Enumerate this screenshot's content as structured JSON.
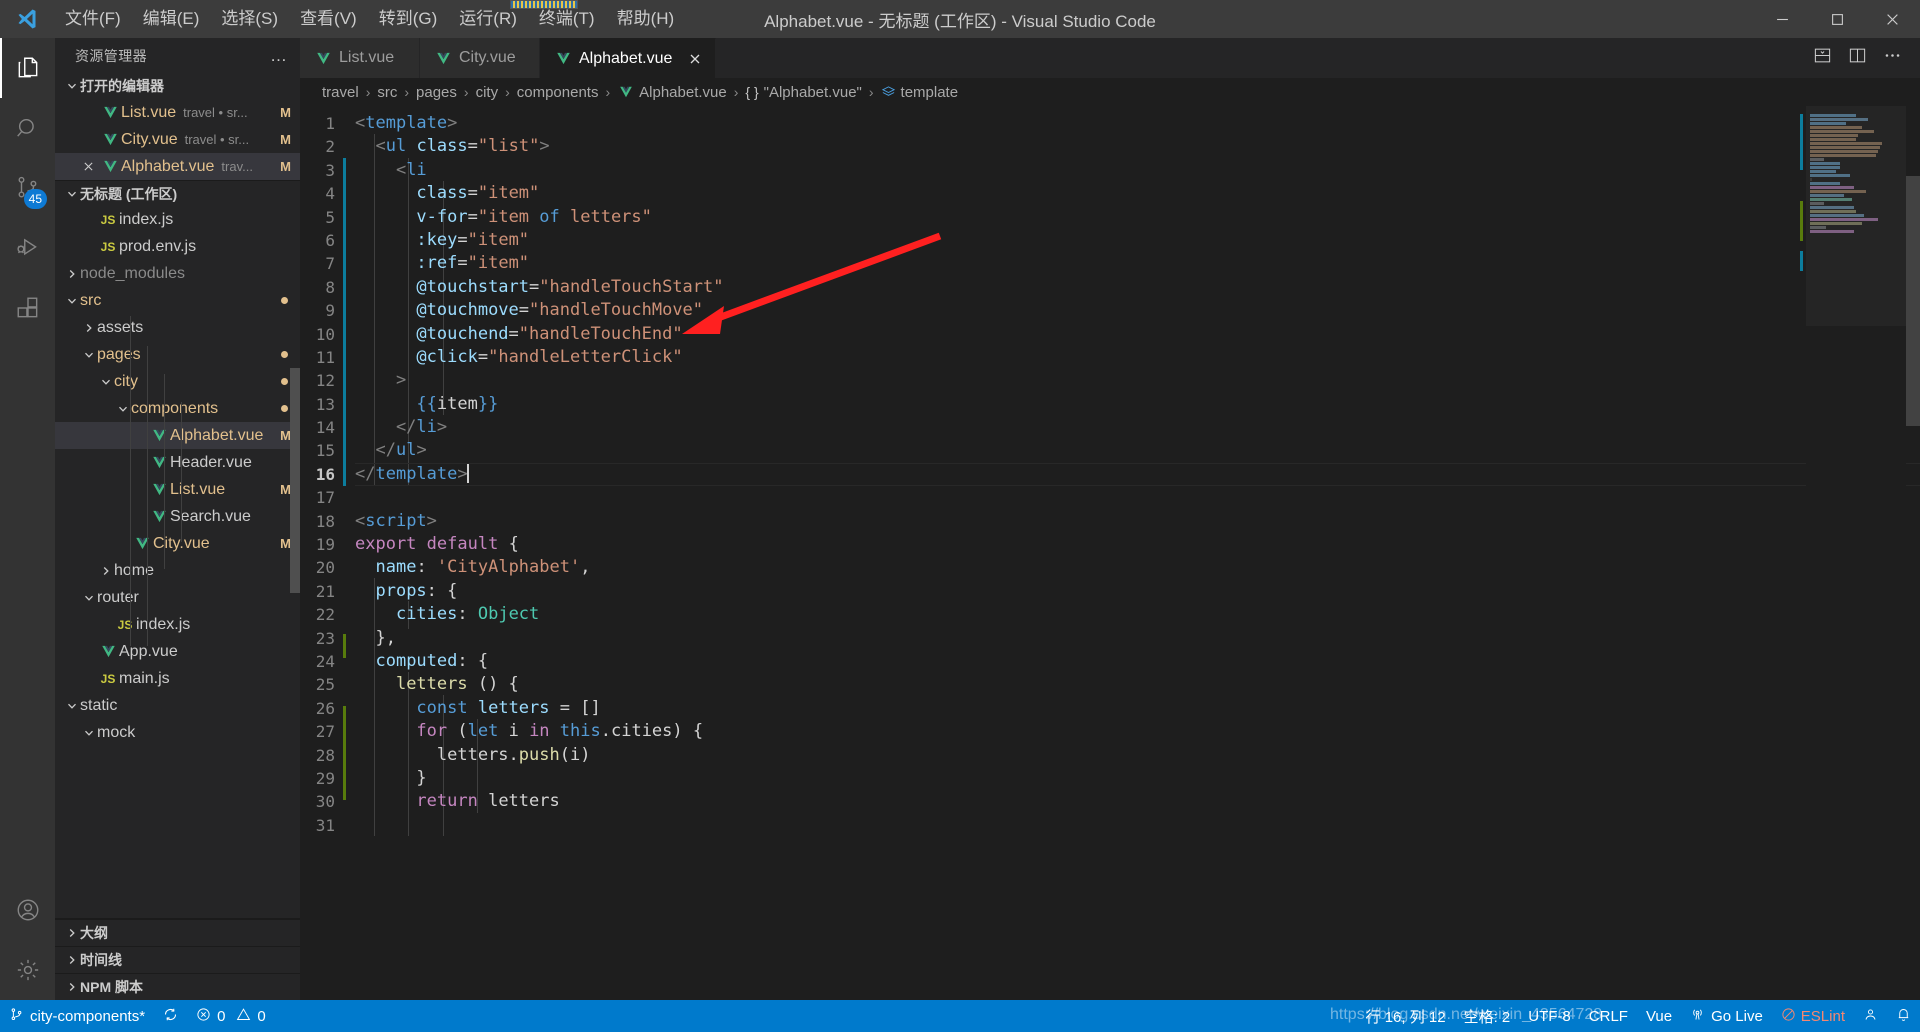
{
  "window": {
    "title": "Alphabet.vue - 无标题 (工作区) - Visual Studio Code",
    "logo_icon": "vscode-logo-icon",
    "minimize_icon": "minimize-icon",
    "maximize_icon": "maximize-icon",
    "close_icon": "close-icon"
  },
  "menu": [
    {
      "label": "文件(F)",
      "name": "menu-file"
    },
    {
      "label": "编辑(E)",
      "name": "menu-edit"
    },
    {
      "label": "选择(S)",
      "name": "menu-selection"
    },
    {
      "label": "查看(V)",
      "name": "menu-view"
    },
    {
      "label": "转到(G)",
      "name": "menu-go"
    },
    {
      "label": "运行(R)",
      "name": "menu-run"
    },
    {
      "label": "终端(T)",
      "name": "menu-terminal"
    },
    {
      "label": "帮助(H)",
      "name": "menu-help"
    }
  ],
  "activitybar": [
    {
      "name": "explorer-icon",
      "badge": ""
    },
    {
      "name": "search-icon",
      "badge": ""
    },
    {
      "name": "source-control-icon",
      "badge": "45"
    },
    {
      "name": "run-debug-icon",
      "badge": ""
    },
    {
      "name": "extensions-icon",
      "badge": ""
    },
    {
      "name": "accounts-icon",
      "badge": ""
    },
    {
      "name": "settings-gear-icon",
      "badge": ""
    }
  ],
  "sidebar": {
    "title": "资源管理器",
    "more_actions": "…",
    "open_editors": {
      "label": "打开的编辑器",
      "items": [
        {
          "filename": "List.vue",
          "desc": "travel • sr...",
          "badge": "M",
          "icon": "vue-icon",
          "selected": false,
          "show_close": false
        },
        {
          "filename": "City.vue",
          "desc": "travel • sr...",
          "badge": "M",
          "icon": "vue-icon",
          "selected": false,
          "show_close": false
        },
        {
          "filename": "Alphabet.vue",
          "desc": "trav...",
          "badge": "M",
          "icon": "vue-icon",
          "selected": true,
          "show_close": true
        }
      ]
    },
    "workspace": {
      "label": "无标题 (工作区)",
      "items": [
        {
          "label": "index.js",
          "indent": 2,
          "icon": "js-icon",
          "arrow": "",
          "badge": "",
          "color": "plain",
          "selected": false
        },
        {
          "label": "prod.env.js",
          "indent": 2,
          "icon": "js-icon",
          "arrow": "",
          "badge": "",
          "color": "plain",
          "selected": false
        },
        {
          "label": "node_modules",
          "indent": 1,
          "icon": "folder",
          "arrow": "right",
          "badge": "",
          "color": "dim",
          "selected": false
        },
        {
          "label": "src",
          "indent": 1,
          "icon": "folder",
          "arrow": "down",
          "badge": "dot",
          "color": "folder",
          "selected": false
        },
        {
          "label": "assets",
          "indent": 2,
          "icon": "folder",
          "arrow": "right",
          "badge": "",
          "color": "plain",
          "selected": false
        },
        {
          "label": "pages",
          "indent": 2,
          "icon": "folder",
          "arrow": "down",
          "badge": "dot",
          "color": "folder",
          "selected": false
        },
        {
          "label": "city",
          "indent": 3,
          "icon": "folder",
          "arrow": "down",
          "badge": "dot",
          "color": "folder",
          "selected": false
        },
        {
          "label": "components",
          "indent": 4,
          "icon": "folder",
          "arrow": "down",
          "badge": "dot",
          "color": "folder",
          "selected": false
        },
        {
          "label": "Alphabet.vue",
          "indent": 5,
          "icon": "vue-icon",
          "arrow": "",
          "badge": "M",
          "color": "vue",
          "selected": true
        },
        {
          "label": "Header.vue",
          "indent": 5,
          "icon": "vue-icon",
          "arrow": "",
          "badge": "",
          "color": "plain",
          "selected": false
        },
        {
          "label": "List.vue",
          "indent": 5,
          "icon": "vue-icon",
          "arrow": "",
          "badge": "M",
          "color": "vue",
          "selected": false
        },
        {
          "label": "Search.vue",
          "indent": 5,
          "icon": "vue-icon",
          "arrow": "",
          "badge": "",
          "color": "plain",
          "selected": false
        },
        {
          "label": "City.vue",
          "indent": 4,
          "icon": "vue-icon",
          "arrow": "",
          "badge": "M",
          "color": "vue",
          "selected": false
        },
        {
          "label": "home",
          "indent": 3,
          "icon": "folder",
          "arrow": "right",
          "badge": "",
          "color": "plain",
          "selected": false
        },
        {
          "label": "router",
          "indent": 2,
          "icon": "folder",
          "arrow": "down",
          "badge": "",
          "color": "plain",
          "selected": false
        },
        {
          "label": "index.js",
          "indent": 3,
          "icon": "js-icon",
          "arrow": "",
          "badge": "",
          "color": "plain",
          "selected": false
        },
        {
          "label": "App.vue",
          "indent": 2,
          "icon": "vue-icon",
          "arrow": "",
          "badge": "",
          "color": "plain",
          "selected": false
        },
        {
          "label": "main.js",
          "indent": 2,
          "icon": "js-icon",
          "arrow": "",
          "badge": "",
          "color": "plain",
          "selected": false
        },
        {
          "label": "static",
          "indent": 1,
          "icon": "folder",
          "arrow": "down",
          "badge": "",
          "color": "plain",
          "selected": false
        },
        {
          "label": "mock",
          "indent": 2,
          "icon": "folder",
          "arrow": "down",
          "badge": "",
          "color": "plain",
          "selected": false
        }
      ]
    },
    "panels": [
      {
        "label": "大纲",
        "name": "sidebar-panel-outline"
      },
      {
        "label": "时间线",
        "name": "sidebar-panel-timeline"
      },
      {
        "label": "NPM 脚本",
        "name": "sidebar-panel-npm-scripts"
      }
    ]
  },
  "tabs": [
    {
      "label": "List.vue",
      "icon": "vue-icon",
      "active": false,
      "closable": false
    },
    {
      "label": "City.vue",
      "icon": "vue-icon",
      "active": false,
      "closable": false
    },
    {
      "label": "Alphabet.vue",
      "icon": "vue-icon",
      "active": true,
      "closable": true
    }
  ],
  "tab_actions": [
    {
      "name": "split-editor-down-icon"
    },
    {
      "name": "split-editor-right-icon"
    },
    {
      "name": "more-actions-icon"
    }
  ],
  "breadcrumbs": [
    {
      "label": "travel",
      "icon": ""
    },
    {
      "label": "src",
      "icon": ""
    },
    {
      "label": "pages",
      "icon": ""
    },
    {
      "label": "city",
      "icon": ""
    },
    {
      "label": "components",
      "icon": ""
    },
    {
      "label": "Alphabet.vue",
      "icon": "vue-icon"
    },
    {
      "label": "\"Alphabet.vue\"",
      "icon": "braces-icon"
    },
    {
      "label": "template",
      "icon": "template-symbol-icon"
    }
  ],
  "code": {
    "lines": [
      {
        "n": 1,
        "tokens": [
          {
            "t": "<",
            "c": "t-punc"
          },
          {
            "t": "template",
            "c": "t-tag"
          },
          {
            "t": ">",
            "c": "t-punc"
          }
        ]
      },
      {
        "n": 2,
        "tokens": [
          {
            "t": "  <",
            "c": "t-punc"
          },
          {
            "t": "ul",
            "c": "t-tag"
          },
          {
            "t": " ",
            "c": "t-plain"
          },
          {
            "t": "class",
            "c": "t-attr"
          },
          {
            "t": "=",
            "c": "t-eq"
          },
          {
            "t": "\"list\"",
            "c": "t-str"
          },
          {
            "t": ">",
            "c": "t-punc"
          }
        ]
      },
      {
        "n": 3,
        "tokens": [
          {
            "t": "    <",
            "c": "t-punc"
          },
          {
            "t": "li",
            "c": "t-tag"
          }
        ]
      },
      {
        "n": 4,
        "tokens": [
          {
            "t": "      ",
            "c": "t-plain"
          },
          {
            "t": "class",
            "c": "t-attr"
          },
          {
            "t": "=",
            "c": "t-eq"
          },
          {
            "t": "\"item\"",
            "c": "t-str"
          }
        ]
      },
      {
        "n": 5,
        "tokens": [
          {
            "t": "      ",
            "c": "t-plain"
          },
          {
            "t": "v-for",
            "c": "t-attr"
          },
          {
            "t": "=",
            "c": "t-eq"
          },
          {
            "t": "\"item",
            "c": "t-str"
          },
          {
            "t": " of ",
            "c": "t-kw2"
          },
          {
            "t": "letters\"",
            "c": "t-str"
          }
        ]
      },
      {
        "n": 6,
        "tokens": [
          {
            "t": "      ",
            "c": "t-plain"
          },
          {
            "t": ":key",
            "c": "t-attr"
          },
          {
            "t": "=",
            "c": "t-eq"
          },
          {
            "t": "\"item\"",
            "c": "t-str"
          }
        ]
      },
      {
        "n": 7,
        "tokens": [
          {
            "t": "      ",
            "c": "t-plain"
          },
          {
            "t": ":ref",
            "c": "t-attr"
          },
          {
            "t": "=",
            "c": "t-eq"
          },
          {
            "t": "\"item\"",
            "c": "t-str"
          }
        ]
      },
      {
        "n": 8,
        "tokens": [
          {
            "t": "      ",
            "c": "t-plain"
          },
          {
            "t": "@touchstart",
            "c": "t-attr"
          },
          {
            "t": "=",
            "c": "t-eq"
          },
          {
            "t": "\"handleTouchStart\"",
            "c": "t-str"
          }
        ]
      },
      {
        "n": 9,
        "tokens": [
          {
            "t": "      ",
            "c": "t-plain"
          },
          {
            "t": "@touchmove",
            "c": "t-attr"
          },
          {
            "t": "=",
            "c": "t-eq"
          },
          {
            "t": "\"handleTouchMove\"",
            "c": "t-str"
          }
        ]
      },
      {
        "n": 10,
        "tokens": [
          {
            "t": "      ",
            "c": "t-plain"
          },
          {
            "t": "@touchend",
            "c": "t-attr"
          },
          {
            "t": "=",
            "c": "t-eq"
          },
          {
            "t": "\"handleTouchEnd\"",
            "c": "t-str"
          }
        ]
      },
      {
        "n": 11,
        "tokens": [
          {
            "t": "      ",
            "c": "t-plain"
          },
          {
            "t": "@click",
            "c": "t-attr"
          },
          {
            "t": "=",
            "c": "t-eq"
          },
          {
            "t": "\"handleLetterClick\"",
            "c": "t-str"
          }
        ]
      },
      {
        "n": 12,
        "tokens": [
          {
            "t": "    >",
            "c": "t-punc"
          }
        ]
      },
      {
        "n": 13,
        "tokens": [
          {
            "t": "      ",
            "c": "t-plain"
          },
          {
            "t": "{{",
            "c": "t-interp"
          },
          {
            "t": "item",
            "c": "t-plain"
          },
          {
            "t": "}}",
            "c": "t-interp"
          }
        ]
      },
      {
        "n": 14,
        "tokens": [
          {
            "t": "    </",
            "c": "t-punc"
          },
          {
            "t": "li",
            "c": "t-tag"
          },
          {
            "t": ">",
            "c": "t-punc"
          }
        ]
      },
      {
        "n": 15,
        "tokens": [
          {
            "t": "  </",
            "c": "t-punc"
          },
          {
            "t": "ul",
            "c": "t-tag"
          },
          {
            "t": ">",
            "c": "t-punc"
          }
        ]
      },
      {
        "n": 16,
        "tokens": [
          {
            "t": "</",
            "c": "t-punc"
          },
          {
            "t": "template",
            "c": "t-tag"
          },
          {
            "t": ">",
            "c": "t-punc"
          }
        ],
        "current": true,
        "cursor": true
      },
      {
        "n": 17,
        "tokens": []
      },
      {
        "n": 18,
        "tokens": [
          {
            "t": "<",
            "c": "t-punc"
          },
          {
            "t": "script",
            "c": "t-tag"
          },
          {
            "t": ">",
            "c": "t-punc"
          }
        ]
      },
      {
        "n": 19,
        "tokens": [
          {
            "t": "export",
            "c": "t-kw"
          },
          {
            "t": " ",
            "c": "t-plain"
          },
          {
            "t": "default",
            "c": "t-kw"
          },
          {
            "t": " {",
            "c": "t-brace"
          }
        ]
      },
      {
        "n": 20,
        "tokens": [
          {
            "t": "  ",
            "c": "t-plain"
          },
          {
            "t": "name",
            "c": "t-prop"
          },
          {
            "t": ": ",
            "c": "t-plain"
          },
          {
            "t": "'CityAlphabet'",
            "c": "t-str"
          },
          {
            "t": ",",
            "c": "t-plain"
          }
        ]
      },
      {
        "n": 21,
        "tokens": [
          {
            "t": "  ",
            "c": "t-plain"
          },
          {
            "t": "props",
            "c": "t-prop"
          },
          {
            "t": ": {",
            "c": "t-plain"
          }
        ]
      },
      {
        "n": 22,
        "tokens": [
          {
            "t": "    ",
            "c": "t-plain"
          },
          {
            "t": "cities",
            "c": "t-prop"
          },
          {
            "t": ": ",
            "c": "t-plain"
          },
          {
            "t": "Object",
            "c": "t-type"
          }
        ]
      },
      {
        "n": 23,
        "tokens": [
          {
            "t": "  },",
            "c": "t-plain"
          }
        ]
      },
      {
        "n": 24,
        "tokens": [
          {
            "t": "  ",
            "c": "t-plain"
          },
          {
            "t": "computed",
            "c": "t-prop"
          },
          {
            "t": ": {",
            "c": "t-plain"
          }
        ]
      },
      {
        "n": 25,
        "tokens": [
          {
            "t": "    ",
            "c": "t-plain"
          },
          {
            "t": "letters",
            "c": "t-fn"
          },
          {
            "t": " () {",
            "c": "t-plain"
          }
        ]
      },
      {
        "n": 26,
        "tokens": [
          {
            "t": "      ",
            "c": "t-plain"
          },
          {
            "t": "const",
            "c": "t-kw2"
          },
          {
            "t": " ",
            "c": "t-plain"
          },
          {
            "t": "letters",
            "c": "t-prop"
          },
          {
            "t": " = []",
            "c": "t-plain"
          }
        ]
      },
      {
        "n": 27,
        "tokens": [
          {
            "t": "      ",
            "c": "t-plain"
          },
          {
            "t": "for",
            "c": "t-kw"
          },
          {
            "t": " (",
            "c": "t-plain"
          },
          {
            "t": "let",
            "c": "t-kw2"
          },
          {
            "t": " i ",
            "c": "t-plain"
          },
          {
            "t": "in",
            "c": "t-kw"
          },
          {
            "t": " ",
            "c": "t-plain"
          },
          {
            "t": "this",
            "c": "t-kw2"
          },
          {
            "t": ".cities) {",
            "c": "t-plain"
          }
        ]
      },
      {
        "n": 28,
        "tokens": [
          {
            "t": "        ",
            "c": "t-plain"
          },
          {
            "t": "letters",
            "c": "t-plain"
          },
          {
            "t": ".",
            "c": "t-plain"
          },
          {
            "t": "push",
            "c": "t-fn"
          },
          {
            "t": "(i)",
            "c": "t-plain"
          }
        ]
      },
      {
        "n": 29,
        "tokens": [
          {
            "t": "      }",
            "c": "t-plain"
          }
        ]
      },
      {
        "n": 30,
        "tokens": [
          {
            "t": "      ",
            "c": "t-plain"
          },
          {
            "t": "return",
            "c": "t-kw"
          },
          {
            "t": " letters",
            "c": "t-plain"
          }
        ]
      },
      {
        "n": 31,
        "tokens": []
      }
    ]
  },
  "statusbar": {
    "left": [
      {
        "name": "status-branch",
        "icon": "source-control-icon",
        "label": "city-components*"
      },
      {
        "name": "status-sync",
        "icon": "sync-icon",
        "label": ""
      },
      {
        "name": "status-problems",
        "icon": "error-warning-icon",
        "label": "0  0",
        "errors": "0",
        "warnings": "0"
      }
    ],
    "right": [
      {
        "name": "status-cursor-position",
        "label": "行 16, 列 12"
      },
      {
        "name": "status-indentation",
        "label": "空格: 2"
      },
      {
        "name": "status-encoding",
        "label": "UTF-8"
      },
      {
        "name": "status-eol",
        "label": "CRLF"
      },
      {
        "name": "status-language-mode",
        "label": "Vue"
      },
      {
        "name": "status-go-live",
        "label": "Go Live",
        "icon": "broadcast-icon"
      },
      {
        "name": "status-eslint",
        "label": "ESLint",
        "icon": "eslint-icon"
      },
      {
        "name": "status-account",
        "label": "",
        "icon": "account-icon"
      },
      {
        "name": "status-notifications",
        "label": "",
        "icon": "bell-icon"
      }
    ]
  },
  "watermark": "https://blog.csdn.net/weixin_43564728",
  "annotation": {
    "name": "red-arrow-annotation",
    "color": "#ff2020"
  },
  "colors": {
    "accent": "#007acc",
    "titlebar_bg": "#3c3c3c",
    "sidebar_bg": "#252526",
    "editor_bg": "#1e1e1e",
    "activitybar_bg": "#333333",
    "selection_bg": "#37373d",
    "modified_badge": "#e2c08d",
    "vue_green": "#41b883"
  }
}
